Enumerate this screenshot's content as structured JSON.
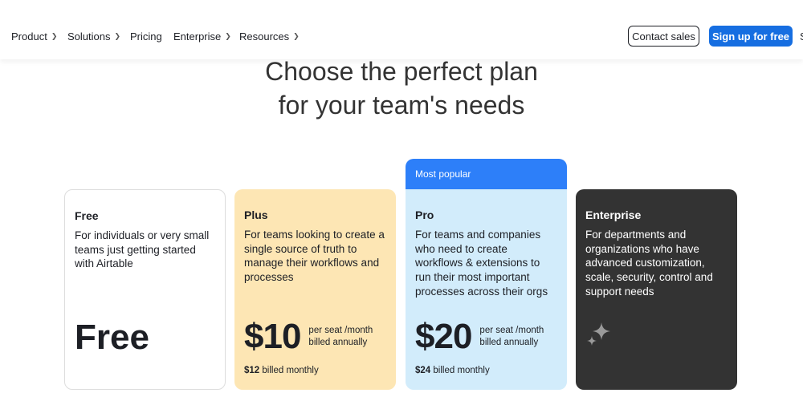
{
  "nav": {
    "items": [
      {
        "label": "Product",
        "has_chevron": true
      },
      {
        "label": "Solutions",
        "has_chevron": true
      },
      {
        "label": "Pricing",
        "has_chevron": false
      },
      {
        "label": "Enterprise",
        "has_chevron": true
      },
      {
        "label": "Resources",
        "has_chevron": true
      }
    ],
    "contact_label": "Contact sales",
    "signup_label": "Sign up for free",
    "cut_off_label": "S"
  },
  "headline": {
    "line1": "Choose the perfect plan",
    "line2": "for your team's needs"
  },
  "plans": {
    "free": {
      "name": "Free",
      "description": "For individuals or very small teams just getting started with Airtable",
      "price": "Free"
    },
    "plus": {
      "name": "Plus",
      "description": "For teams looking to create a single source of truth to manage their workflows and processes",
      "price": "$10",
      "price_note_line1": "per seat /month",
      "price_note_line2": "billed annually",
      "monthly_price": "$12",
      "monthly_label": "billed monthly"
    },
    "pro": {
      "badge": "Most popular",
      "name": "Pro",
      "description": "For teams and companies who need to create workflows & extensions to run their most important processes across their orgs",
      "price": "$20",
      "price_note_line1": "per seat /month",
      "price_note_line2": "billed annually",
      "monthly_price": "$24",
      "monthly_label": "billed monthly"
    },
    "enterprise": {
      "name": "Enterprise",
      "description": "For departments and organizations who have advanced customization, scale, security, control and support needs",
      "icon": "sparkle-icon"
    }
  },
  "colors": {
    "signup_button": "#166ee1",
    "plus_card": "#fde6b4",
    "pro_card": "#d2ecfb",
    "popular_badge": "#2d7ff9",
    "enterprise_card": "#333333"
  }
}
